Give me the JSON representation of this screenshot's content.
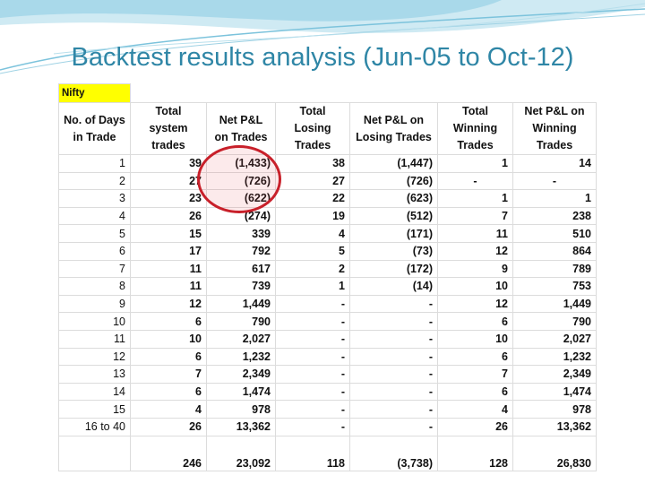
{
  "title": "Backtest results analysis (Jun-05 to Oct-12)",
  "sheet_label": "Nifty",
  "headers": [
    "No. of Days in Trade",
    "Total system trades",
    "Net P&L on Trades",
    "Total Losing Trades",
    "Net P&L on Losing Trades",
    "Total Winning Trades",
    "Net P&L on Winning Trades"
  ],
  "rows": [
    [
      "1",
      "39",
      "(1,433)",
      "38",
      "(1,447)",
      "1",
      "14"
    ],
    [
      "2",
      "27",
      "(726)",
      "27",
      "(726)",
      "-",
      "-"
    ],
    [
      "3",
      "23",
      "(622)",
      "22",
      "(623)",
      "1",
      "1"
    ],
    [
      "4",
      "26",
      "(274)",
      "19",
      "(512)",
      "7",
      "238"
    ],
    [
      "5",
      "15",
      "339",
      "4",
      "(171)",
      "11",
      "510"
    ],
    [
      "6",
      "17",
      "792",
      "5",
      "(73)",
      "12",
      "864"
    ],
    [
      "7",
      "11",
      "617",
      "2",
      "(172)",
      "9",
      "789"
    ],
    [
      "8",
      "11",
      "739",
      "1",
      "(14)",
      "10",
      "753"
    ],
    [
      "9",
      "12",
      "1,449",
      "-",
      "-",
      "12",
      "1,449"
    ],
    [
      "10",
      "6",
      "790",
      "-",
      "-",
      "6",
      "790"
    ],
    [
      "11",
      "10",
      "2,027",
      "-",
      "-",
      "10",
      "2,027"
    ],
    [
      "12",
      "6",
      "1,232",
      "-",
      "-",
      "6",
      "1,232"
    ],
    [
      "13",
      "7",
      "2,349",
      "-",
      "-",
      "7",
      "2,349"
    ],
    [
      "14",
      "6",
      "1,474",
      "-",
      "-",
      "6",
      "1,474"
    ],
    [
      "15",
      "4",
      "978",
      "-",
      "-",
      "4",
      "978"
    ],
    [
      "16 to 40",
      "26",
      "13,362",
      "-",
      "-",
      "26",
      "13,362"
    ]
  ],
  "totals": [
    "",
    "246",
    "23,092",
    "118",
    "(3,738)",
    "128",
    "26,830"
  ],
  "colors": {
    "title": "#2f86a6",
    "highlight": "#ffff00",
    "circle": "#c8202a"
  }
}
